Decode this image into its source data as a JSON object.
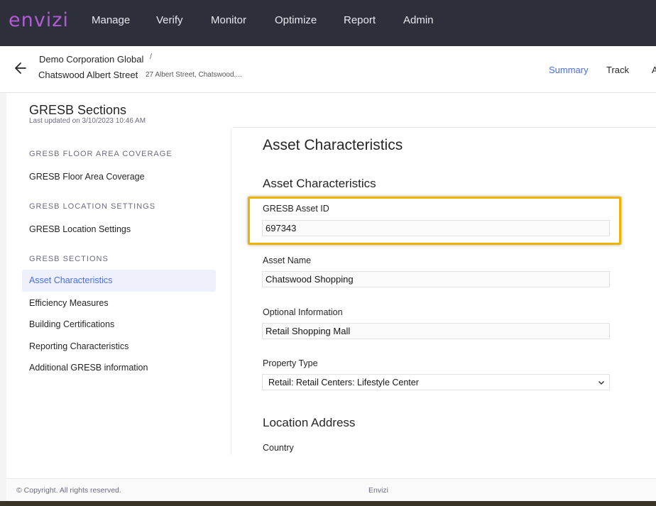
{
  "brand": {
    "logo": "envizi",
    "logo_color": "#b25bd6"
  },
  "nav": {
    "items": [
      "Manage",
      "Verify",
      "Monitor",
      "Optimize",
      "Report",
      "Admin"
    ]
  },
  "breadcrumb": {
    "org": "Demo Corporation Global",
    "separator": "/",
    "site": "Chatswood Albert Street",
    "address": "27 Albert Street, Chatswood,..."
  },
  "tabs": {
    "summary": "Summary",
    "track": "Track",
    "partial": "A"
  },
  "sidebar": {
    "title": "GRESB Sections",
    "updated": "Last updated on 3/10/2023 10:46 AM",
    "groups": [
      {
        "heading": "GRESB FLOOR AREA COVERAGE",
        "items": [
          "GRESB Floor Area Coverage"
        ]
      },
      {
        "heading": "GRESB LOCATION SETTINGS",
        "items": [
          "GRESB Location Settings"
        ]
      },
      {
        "heading": "GRESB SECTIONS",
        "active": "Asset Characteristics",
        "items": [
          "Efficiency Measures",
          "Building Certifications",
          "Reporting Characteristics",
          "Additional GRESB information"
        ]
      }
    ]
  },
  "main": {
    "heading": "Asset Characteristics",
    "subheading": "Asset Characteristics",
    "fields": {
      "asset_id_label": "GRESB Asset ID",
      "asset_id_value": "697343",
      "asset_name_label": "Asset Name",
      "asset_name_value": "Chatswood Shopping",
      "optional_label": "Optional Information",
      "optional_value": "Retail Shopping Mall",
      "property_type_label": "Property Type",
      "property_type_value": "Retail: Retail Centers: Lifestyle Center"
    },
    "location_heading": "Location Address",
    "country_label": "Country"
  },
  "footer": {
    "copyright": "© Copyright. All rights reserved.",
    "brand": "Envizi"
  },
  "colors": {
    "accent": "#4a6fe3",
    "highlight": "#f0b400",
    "nav_bg": "#2d2f3b"
  }
}
